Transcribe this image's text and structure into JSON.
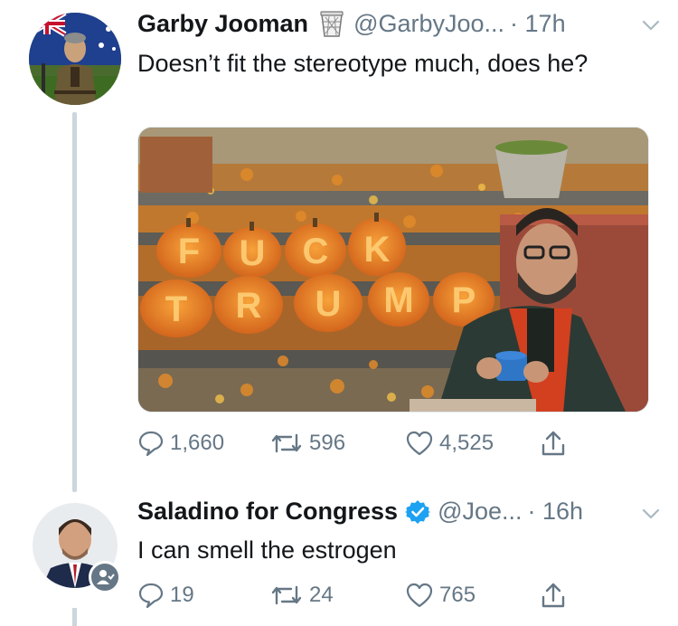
{
  "tweets": [
    {
      "name": "Garby Jooman",
      "name_icon": "trash-can-icon",
      "handle": "@GarbyJoo...",
      "time": "· 17h",
      "text": "Doesn’t fit the stereotype much, does he?",
      "media": {
        "pumpkin_letters": [
          "F",
          "U",
          "C",
          "K",
          "T",
          "R",
          "U",
          "M",
          "P"
        ]
      },
      "actions": {
        "replies": "1,660",
        "retweets": "596",
        "likes": "4,525"
      }
    },
    {
      "name": "Saladino for Congress",
      "badge": "verified-badge-icon",
      "handle": "@Joe...",
      "time": "· 16h",
      "text": "I can smell the estrogen",
      "avatar_badge": "follow-user-icon",
      "actions": {
        "replies": "19",
        "retweets": "24",
        "likes": "765"
      }
    }
  ],
  "colors": {
    "text": "#14171a",
    "secondary": "#657786",
    "verified": "#1da1f2",
    "thread_line": "#ccd6dd"
  }
}
